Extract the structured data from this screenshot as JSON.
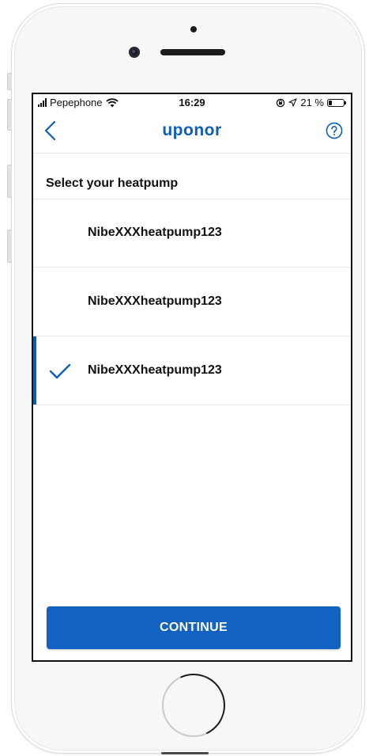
{
  "status_bar": {
    "carrier": "Pepephone",
    "time": "16:29",
    "battery_text": "21 %",
    "icons": [
      "signal-icon",
      "wifi-icon",
      "rotation-lock-icon",
      "location-icon",
      "battery-icon"
    ]
  },
  "nav": {
    "brand": "uponor",
    "back_icon": "chevron-left-icon",
    "help_icon": "question-circle-icon"
  },
  "page": {
    "title": "Select your heatpump"
  },
  "heatpumps": [
    {
      "label": "NibeXXXheatpump123",
      "selected": false
    },
    {
      "label": "NibeXXXheatpump123",
      "selected": false
    },
    {
      "label": "NibeXXXheatpump123",
      "selected": true
    }
  ],
  "actions": {
    "continue_label": "CONTINUE"
  },
  "colors": {
    "accent": "#0b5fb8",
    "button": "#1262c2",
    "divider": "#e5e7ea"
  }
}
